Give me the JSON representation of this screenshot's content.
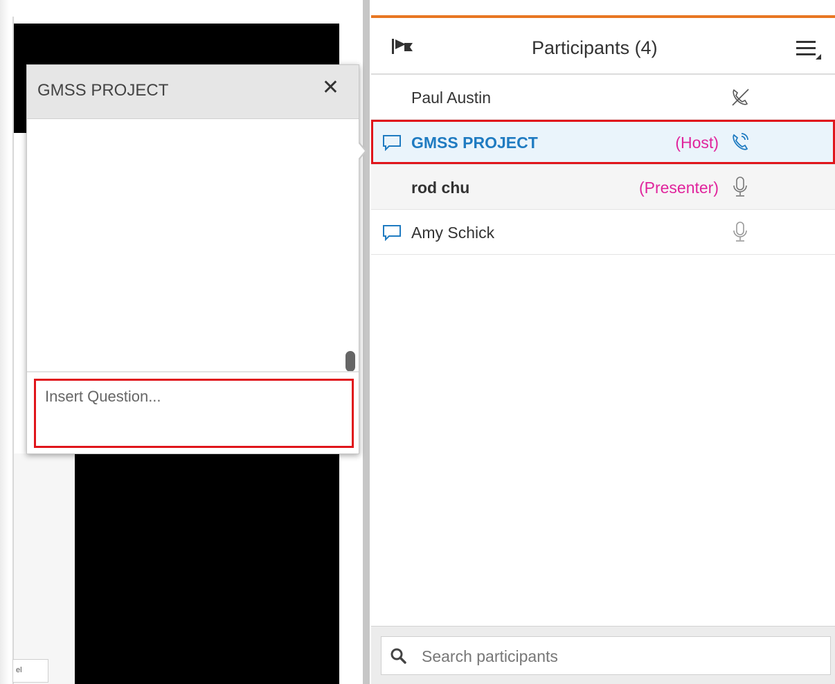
{
  "chat": {
    "title": "GMSS PROJECT",
    "close_label": "✕",
    "input_placeholder": "Insert Question..."
  },
  "stage": {
    "mini_label": "el"
  },
  "participants": {
    "title": "Participants (4)",
    "search_placeholder": "Search participants",
    "accent_color": "#e87722",
    "list": [
      {
        "name": "Paul Austin",
        "role": "",
        "has_chat_icon": false,
        "status_icon": "phone-off-icon"
      },
      {
        "name": "GMSS PROJECT",
        "role": "(Host)",
        "has_chat_icon": true,
        "status_icon": "phone-active-icon",
        "highlighted": true
      },
      {
        "name": "rod chu",
        "role": "(Presenter)",
        "has_chat_icon": false,
        "status_icon": "microphone-icon"
      },
      {
        "name": "Amy Schick",
        "role": "",
        "has_chat_icon": true,
        "status_icon": "microphone-icon"
      }
    ]
  },
  "colors": {
    "host_name": "#1f7bc1",
    "role_label": "#e0249c",
    "highlight_outline": "#e0151b"
  }
}
